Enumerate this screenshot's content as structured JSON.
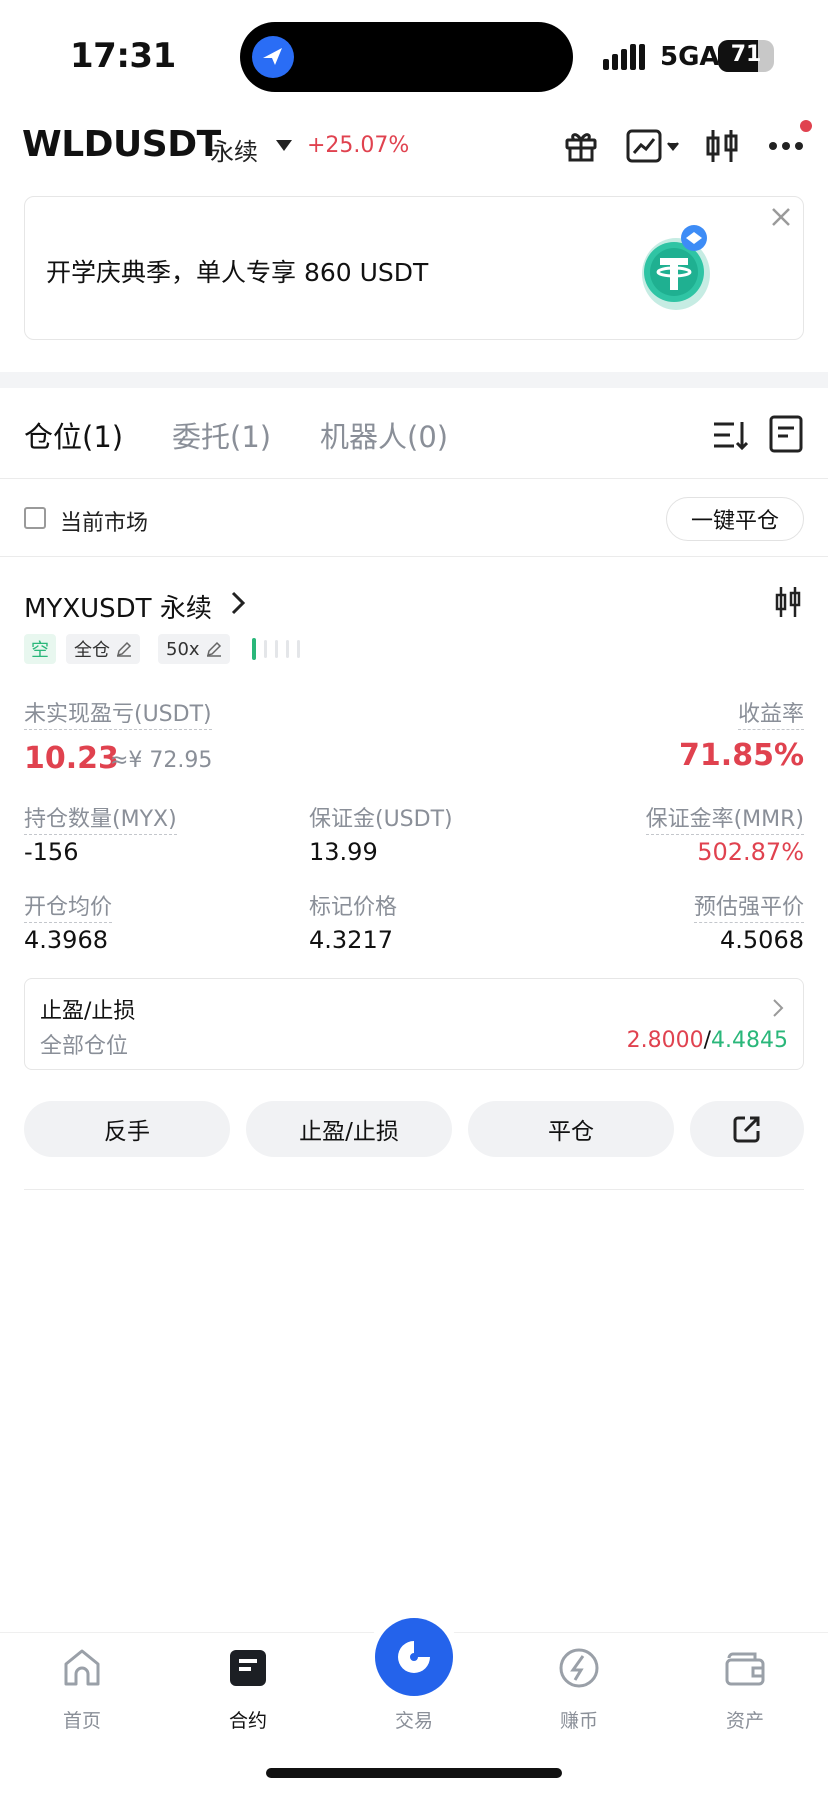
{
  "status_bar": {
    "time": "17:31",
    "network": "5GA",
    "battery": "71",
    "battery_level": 0.71
  },
  "header": {
    "pair": "WLDUSDT",
    "contract_type": "永续",
    "change": "+25.07%",
    "icons": [
      "gift-icon",
      "chart-trend-icon",
      "candlestick-icon",
      "more-icon"
    ]
  },
  "banner": {
    "text": "开学庆典季，单人专享 860 USDT",
    "icon": "tether-coin-icon"
  },
  "tabs": [
    {
      "label": "仓位(1)",
      "active": true
    },
    {
      "label": "委托(1)",
      "active": false
    },
    {
      "label": "机器人(0)",
      "active": false
    }
  ],
  "filter": {
    "current_market": "当前市场",
    "current_market_checked": false,
    "close_all": "一键平仓"
  },
  "position": {
    "symbol": "MYXUSDT 永续",
    "side": "空",
    "margin_mode": "全仓",
    "leverage": "50x",
    "risk_level": 1,
    "unrealized_pnl_label": "未实现盈亏(USDT)",
    "unrealized_pnl": "10.23",
    "unrealized_pnl_cny": "≈¥ 72.95",
    "yield_label": "收益率",
    "yield": "71.85%",
    "qty_label": "持仓数量(MYX)",
    "qty": "-156",
    "margin_label": "保证金(USDT)",
    "margin": "13.99",
    "mmr_label": "保证金率(MMR)",
    "mmr": "502.87%",
    "entry_label": "开仓均价",
    "entry": "4.3968",
    "mark_label": "标记价格",
    "mark": "4.3217",
    "liq_label": "预估强平价",
    "liq": "4.5068",
    "tpsl": {
      "title": "止盈/止损",
      "scope": "全部仓位",
      "tp": "2.8000",
      "separator": "/",
      "sl": "4.4845"
    },
    "actions": {
      "reverse": "反手",
      "tpsl": "止盈/止损",
      "close": "平仓"
    }
  },
  "nav": {
    "home": "首页",
    "futures": "合约",
    "trade": "交易",
    "earn": "赚币",
    "assets": "资产"
  },
  "colors": {
    "up_red": "#e0424f",
    "down_green": "#2ab77a",
    "brand_blue": "#2463eb"
  }
}
